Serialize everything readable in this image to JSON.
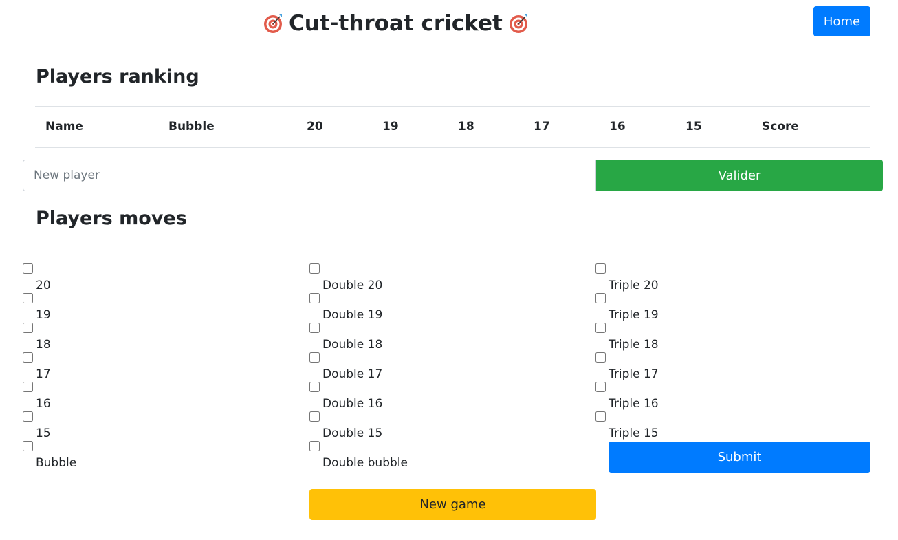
{
  "header": {
    "title": "Cut-throat cricket",
    "home_label": "Home",
    "title_icon": "dart-target-icon"
  },
  "ranking": {
    "title": "Players ranking",
    "columns": [
      "Name",
      "Bubble",
      "20",
      "19",
      "18",
      "17",
      "16",
      "15",
      "Score"
    ],
    "rows": []
  },
  "new_player": {
    "placeholder": "New player",
    "value": "",
    "submit_label": "Valider"
  },
  "moves": {
    "title": "Players moves",
    "singles": [
      "20",
      "19",
      "18",
      "17",
      "16",
      "15",
      "Bubble"
    ],
    "doubles": [
      "Double 20",
      "Double 19",
      "Double 18",
      "Double 17",
      "Double 16",
      "Double 15",
      "Double bubble"
    ],
    "triples": [
      "Triple 20",
      "Triple 19",
      "Triple 18",
      "Triple 17",
      "Triple 16",
      "Triple 15"
    ],
    "submit_label": "Submit",
    "new_game_label": "New game"
  },
  "colors": {
    "primary": "#007bff",
    "success": "#28a745",
    "warning": "#ffc107",
    "text": "#212529"
  }
}
